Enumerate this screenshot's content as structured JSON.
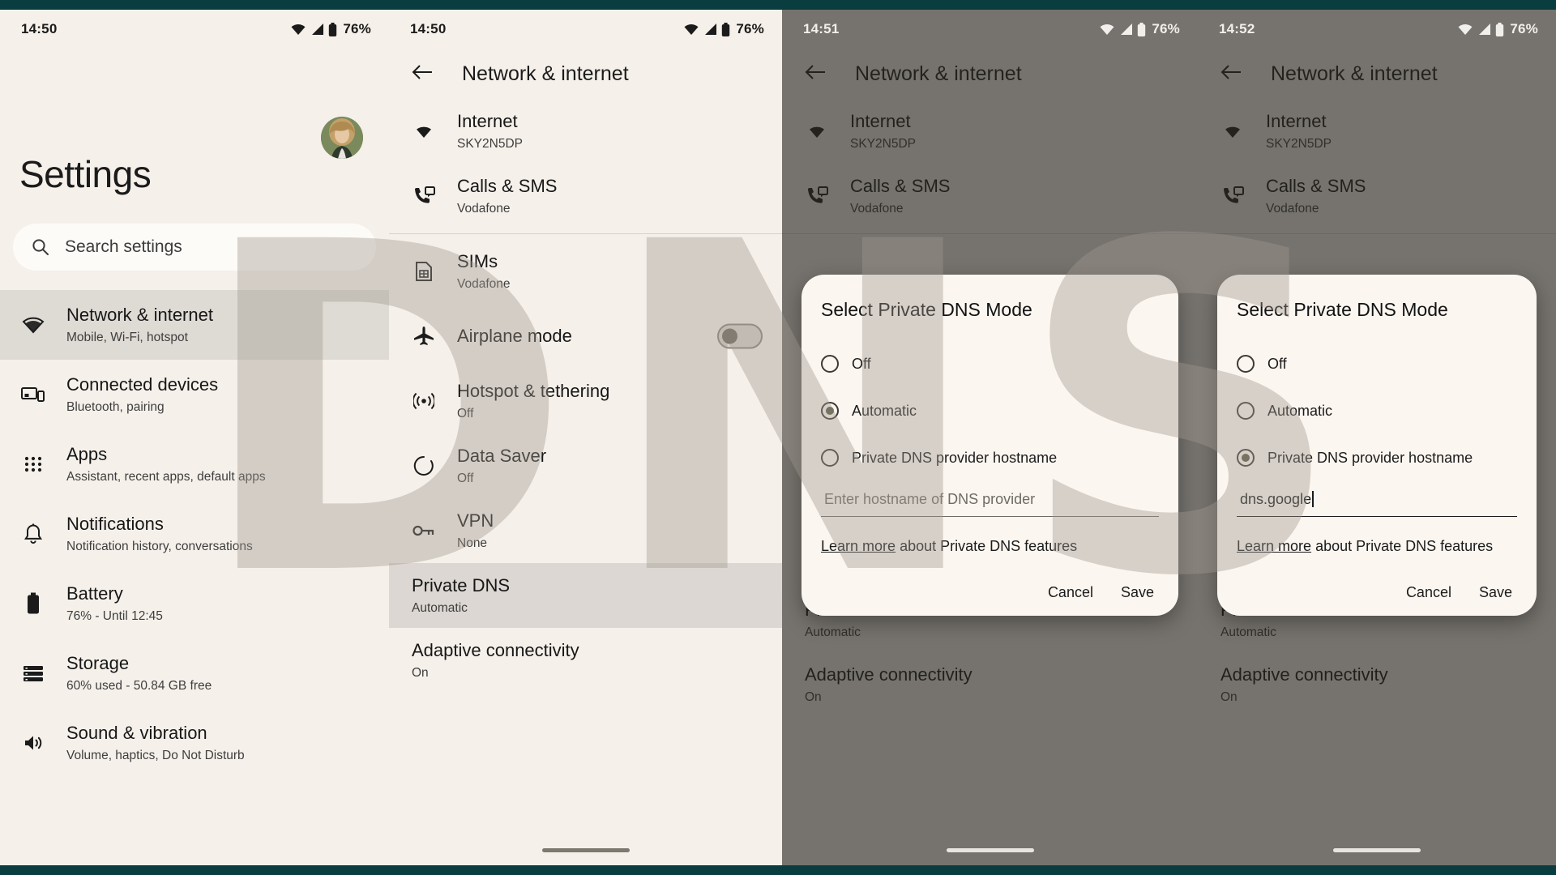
{
  "watermark": {
    "text": "DNS"
  },
  "theme": {
    "frame_color": "#0a3d40",
    "surface": "#f5f0ea",
    "dialog_surface": "#fbf6f0",
    "accent": "#5b5a43"
  },
  "panels": [
    {
      "id": "settings-home",
      "status": {
        "time": "14:50",
        "battery": "76%"
      },
      "page_title": "Settings",
      "search": {
        "placeholder": "Search settings",
        "icon": "search-icon"
      },
      "avatar": {
        "name": "avatar"
      },
      "items": [
        {
          "icon": "wifi-icon",
          "title": "Network & internet",
          "subtitle": "Mobile, Wi-Fi, hotspot",
          "selected": true
        },
        {
          "icon": "devices-icon",
          "title": "Connected devices",
          "subtitle": "Bluetooth, pairing",
          "selected": false
        },
        {
          "icon": "apps-grid-icon",
          "title": "Apps",
          "subtitle": "Assistant, recent apps, default apps",
          "selected": false
        },
        {
          "icon": "bell-icon",
          "title": "Notifications",
          "subtitle": "Notification history, conversations",
          "selected": false
        },
        {
          "icon": "battery-icon",
          "title": "Battery",
          "subtitle": "76% - Until 12:45",
          "selected": false
        },
        {
          "icon": "storage-icon",
          "title": "Storage",
          "subtitle": "60% used - 50.84 GB free",
          "selected": false
        },
        {
          "icon": "volume-icon",
          "title": "Sound & vibration",
          "subtitle": "Volume, haptics, Do Not Disturb",
          "selected": false
        }
      ]
    },
    {
      "id": "network-internet",
      "status": {
        "time": "14:50",
        "battery": "76%"
      },
      "appbar": {
        "back_icon": "back-arrow-icon",
        "title": "Network & internet"
      },
      "items": [
        {
          "icon": "wifi-icon",
          "title": "Internet",
          "subtitle": "SKY2N5DP",
          "control": "none"
        },
        {
          "icon": "calls-sms-icon",
          "title": "Calls & SMS",
          "subtitle": "Vodafone",
          "control": "none"
        },
        {
          "icon": "sim-icon",
          "title": "SIMs",
          "subtitle": "Vodafone",
          "control": "none"
        },
        {
          "icon": "airplane-icon",
          "title": "Airplane mode",
          "subtitle": "",
          "control": "toggle-off"
        },
        {
          "icon": "hotspot-icon",
          "title": "Hotspot & tethering",
          "subtitle": "Off",
          "control": "none"
        },
        {
          "icon": "data-saver-icon",
          "title": "Data Saver",
          "subtitle": "Off",
          "control": "none"
        },
        {
          "icon": "vpn-key-icon",
          "title": "VPN",
          "subtitle": "None",
          "control": "none"
        }
      ],
      "footer_items": [
        {
          "title": "Private DNS",
          "subtitle": "Automatic",
          "highlighted": true
        },
        {
          "title": "Adaptive connectivity",
          "subtitle": "On",
          "highlighted": false
        }
      ]
    },
    {
      "id": "dns-dialog-automatic",
      "status": {
        "time": "14:51",
        "battery": "76%"
      },
      "appbar": {
        "back_icon": "back-arrow-icon",
        "title": "Network & internet"
      },
      "items": [
        {
          "icon": "wifi-icon",
          "title": "Internet",
          "subtitle": "SKY2N5DP"
        },
        {
          "icon": "calls-sms-icon",
          "title": "Calls & SMS",
          "subtitle": "Vodafone"
        }
      ],
      "footer_items": [
        {
          "title": "Private DNS",
          "subtitle": "Automatic"
        },
        {
          "title": "Adaptive connectivity",
          "subtitle": "On"
        }
      ],
      "dialog": {
        "title": "Select Private DNS Mode",
        "options": [
          {
            "label": "Off",
            "selected": false
          },
          {
            "label": "Automatic",
            "selected": true
          },
          {
            "label": "Private DNS provider hostname",
            "selected": false
          }
        ],
        "hostname_placeholder": "Enter hostname of DNS provider",
        "hostname_value": "",
        "show_caret": false,
        "learn_more_link": "Learn more",
        "learn_more_rest": " about Private DNS features",
        "cancel_label": "Cancel",
        "save_label": "Save"
      }
    },
    {
      "id": "dns-dialog-hostname",
      "status": {
        "time": "14:52",
        "battery": "76%"
      },
      "appbar": {
        "back_icon": "back-arrow-icon",
        "title": "Network & internet"
      },
      "items": [
        {
          "icon": "wifi-icon",
          "title": "Internet",
          "subtitle": "SKY2N5DP"
        },
        {
          "icon": "calls-sms-icon",
          "title": "Calls & SMS",
          "subtitle": "Vodafone"
        }
      ],
      "footer_items": [
        {
          "title": "Private DNS",
          "subtitle": "Automatic"
        },
        {
          "title": "Adaptive connectivity",
          "subtitle": "On"
        }
      ],
      "dialog": {
        "title": "Select Private DNS Mode",
        "options": [
          {
            "label": "Off",
            "selected": false
          },
          {
            "label": "Automatic",
            "selected": false
          },
          {
            "label": "Private DNS provider hostname",
            "selected": true
          }
        ],
        "hostname_placeholder": "Enter hostname of DNS provider",
        "hostname_value": "dns.google",
        "show_caret": true,
        "learn_more_link": "Learn more",
        "learn_more_rest": " about Private DNS features",
        "cancel_label": "Cancel",
        "save_label": "Save"
      }
    }
  ]
}
